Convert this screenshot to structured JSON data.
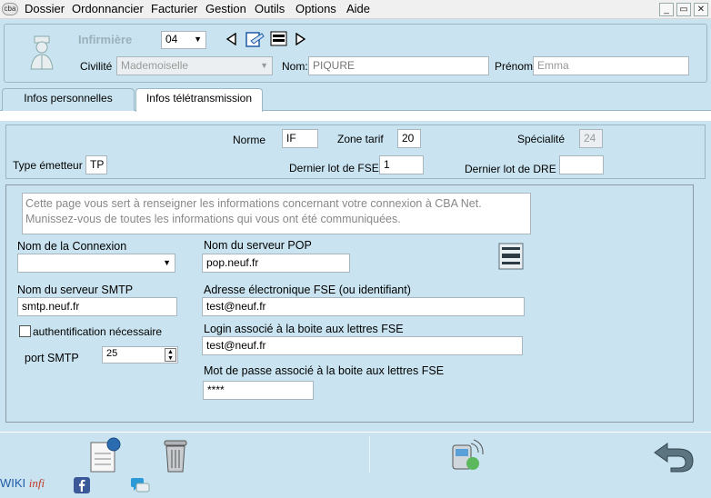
{
  "menu": {
    "logo": "cba",
    "items": [
      "Dossier",
      "Ordonnancier",
      "Facturier",
      "Gestion",
      "Outils",
      "Options",
      "Aide"
    ]
  },
  "window": {
    "minimize": "_",
    "restore": "▭",
    "close": "✕"
  },
  "header": {
    "role": "Infirmière",
    "number": "04",
    "civilite_label": "Civilité",
    "civilite_value": "Mademoiselle",
    "nom_label": "Nom:",
    "nom_value": "PIQURE",
    "prenom_label": "Prénom",
    "prenom_value": "Emma"
  },
  "tabs": {
    "perso": "Infos personnelles",
    "tele": "Infos télétransmission"
  },
  "panel1": {
    "norme_label": "Norme",
    "norme_value": "IF",
    "zone_label": "Zone tarif",
    "zone_value": "20",
    "specialite_label": "Spécialité",
    "specialite_value": "24",
    "type_label": "Type émetteur",
    "type_value": "TP",
    "lot_fse_label": "Dernier lot de FSE :",
    "lot_fse_value": "1",
    "lot_dre_label": "Dernier lot de DRE :",
    "lot_dre_value": ""
  },
  "panel2": {
    "info_line1": "Cette page vous sert à renseigner les informations concernant votre connexion à CBA Net.",
    "info_line2": "Munissez-vous de toutes les informations qui vous ont été communiquées.",
    "connexion_label": "Nom de la Connexion",
    "connexion_value": "",
    "pop_label": "Nom du serveur POP",
    "pop_value": "pop.neuf.fr",
    "smtp_label": "Nom du serveur SMTP",
    "smtp_value": "smtp.neuf.fr",
    "adresse_label": "Adresse électronique FSE (ou identifiant)",
    "adresse_value": "test@neuf.fr",
    "auth_label": "authentification nécessaire",
    "login_label": "Login associé à la boite aux lettres FSE",
    "login_value": "test@neuf.fr",
    "port_label": "port SMTP",
    "port_value": "25",
    "password_label": "Mot de passe associé à la boite aux lettres FSE",
    "password_value": "****"
  },
  "footer": {
    "wiki": "WIKI",
    "infi": "infi"
  },
  "colors": {
    "background": "#c9e4f0",
    "accent": "#1f5aa6"
  }
}
